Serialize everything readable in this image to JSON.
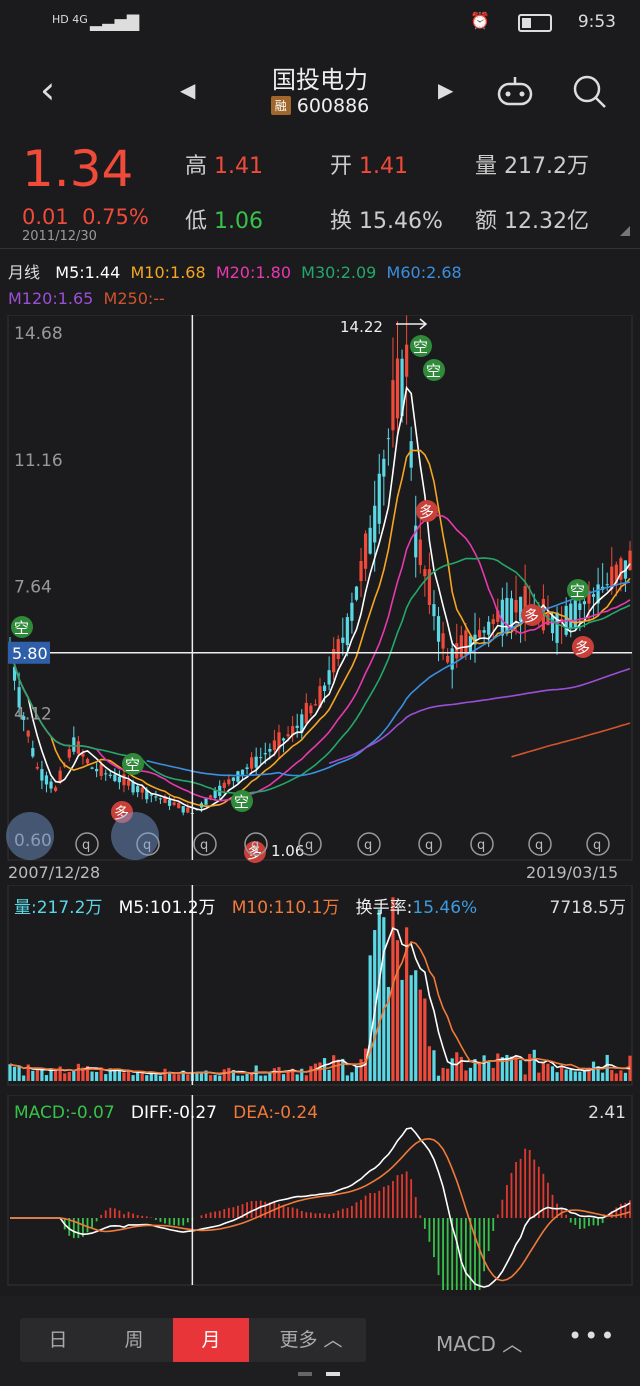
{
  "status": {
    "time": "9:53",
    "net": "HD 4G"
  },
  "header": {
    "title": "国投电力",
    "code": "600886",
    "badge": "融"
  },
  "quote": {
    "price": "1.34",
    "change": "0.01",
    "pct": "0.75%",
    "date": "2011/12/30",
    "high_label": "高",
    "high": "1.41",
    "open_label": "开",
    "open": "1.41",
    "vol_label": "量",
    "vol": "217.2万",
    "low_label": "低",
    "low": "1.06",
    "turn_label": "换",
    "turn": "15.46%",
    "amt_label": "额",
    "amt": "12.32亿"
  },
  "ma": {
    "period": "月线",
    "m5": "M5:1.44",
    "m10": "M10:1.68",
    "m20": "M20:1.80",
    "m30": "M30:2.09",
    "m60": "M60:2.68",
    "m120": "M120:1.65",
    "m250": "M250:--"
  },
  "kchart": {
    "y_ticks": [
      "14.68",
      "11.16",
      "7.64",
      "4.12",
      "0.60"
    ],
    "cursor_price": "5.80",
    "max_label": "14.22",
    "min_label": "1.06",
    "date_start": "2007/12/28",
    "date_end": "2019/03/15",
    "tag_kong": "空",
    "tag_duo": "多",
    "tag_q": "q"
  },
  "volume": {
    "vol": "量:217.2万",
    "m5": "M5:101.2万",
    "m10": "M10:110.1万",
    "turn": "换手率:15.46%",
    "max": "7718.5万"
  },
  "macd": {
    "macd": "MACD:-0.07",
    "diff": "DIFF:-0.27",
    "dea": "DEA:-0.24",
    "max": "2.41"
  },
  "tabbar": {
    "day": "日",
    "week": "周",
    "month": "月",
    "more": "更多 ︿",
    "indicator": "MACD ︿",
    "menu": "•••"
  },
  "colors": {
    "up": "#f04a3a",
    "down": "#5ad8e6",
    "m5": "#ffffff",
    "m10": "#f5a623",
    "m20": "#e838b0",
    "m30": "#23a86b",
    "m60": "#3b8fe0",
    "m120": "#9b4fd6",
    "m250": "#d0532c"
  }
}
